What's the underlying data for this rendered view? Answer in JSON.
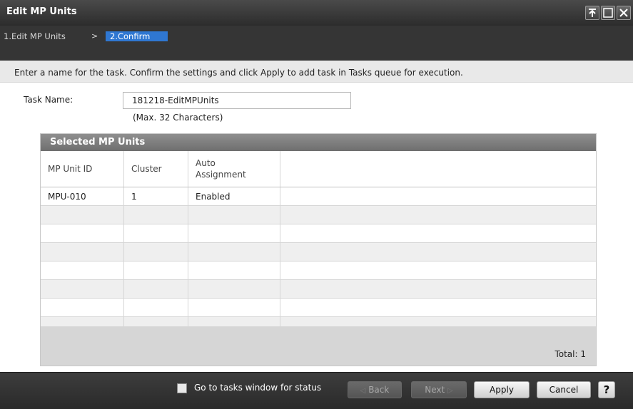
{
  "window": {
    "title": "Edit MP Units"
  },
  "steps": {
    "step1": "1.Edit MP Units",
    "separator": ">",
    "step2": "2.Confirm"
  },
  "instruction": "Enter a name for the task. Confirm the settings and click Apply to add task in Tasks queue for execution.",
  "task": {
    "label": "Task Name:",
    "value": "181218-EditMPUnits",
    "hint": "(Max. 32 Characters)"
  },
  "table": {
    "title": "Selected MP Units",
    "columns": [
      "MP Unit ID",
      "Cluster",
      "Auto Assignment"
    ],
    "rows": [
      {
        "mp_unit_id": "MPU-010",
        "cluster": "1",
        "auto_assignment": "Enabled"
      }
    ],
    "total": "Total:  1"
  },
  "footer": {
    "checkbox_label": "Go to tasks window for status",
    "back": "Back",
    "next": "Next",
    "apply": "Apply",
    "cancel": "Cancel",
    "help": "?"
  },
  "colors": {
    "title_bar": "#2c2c2c",
    "current_step": "#2f77d2",
    "panel_header": "#7a7a7a"
  },
  "icons": [
    "pin-icon",
    "maximize-icon",
    "close-icon",
    "help-icon"
  ]
}
